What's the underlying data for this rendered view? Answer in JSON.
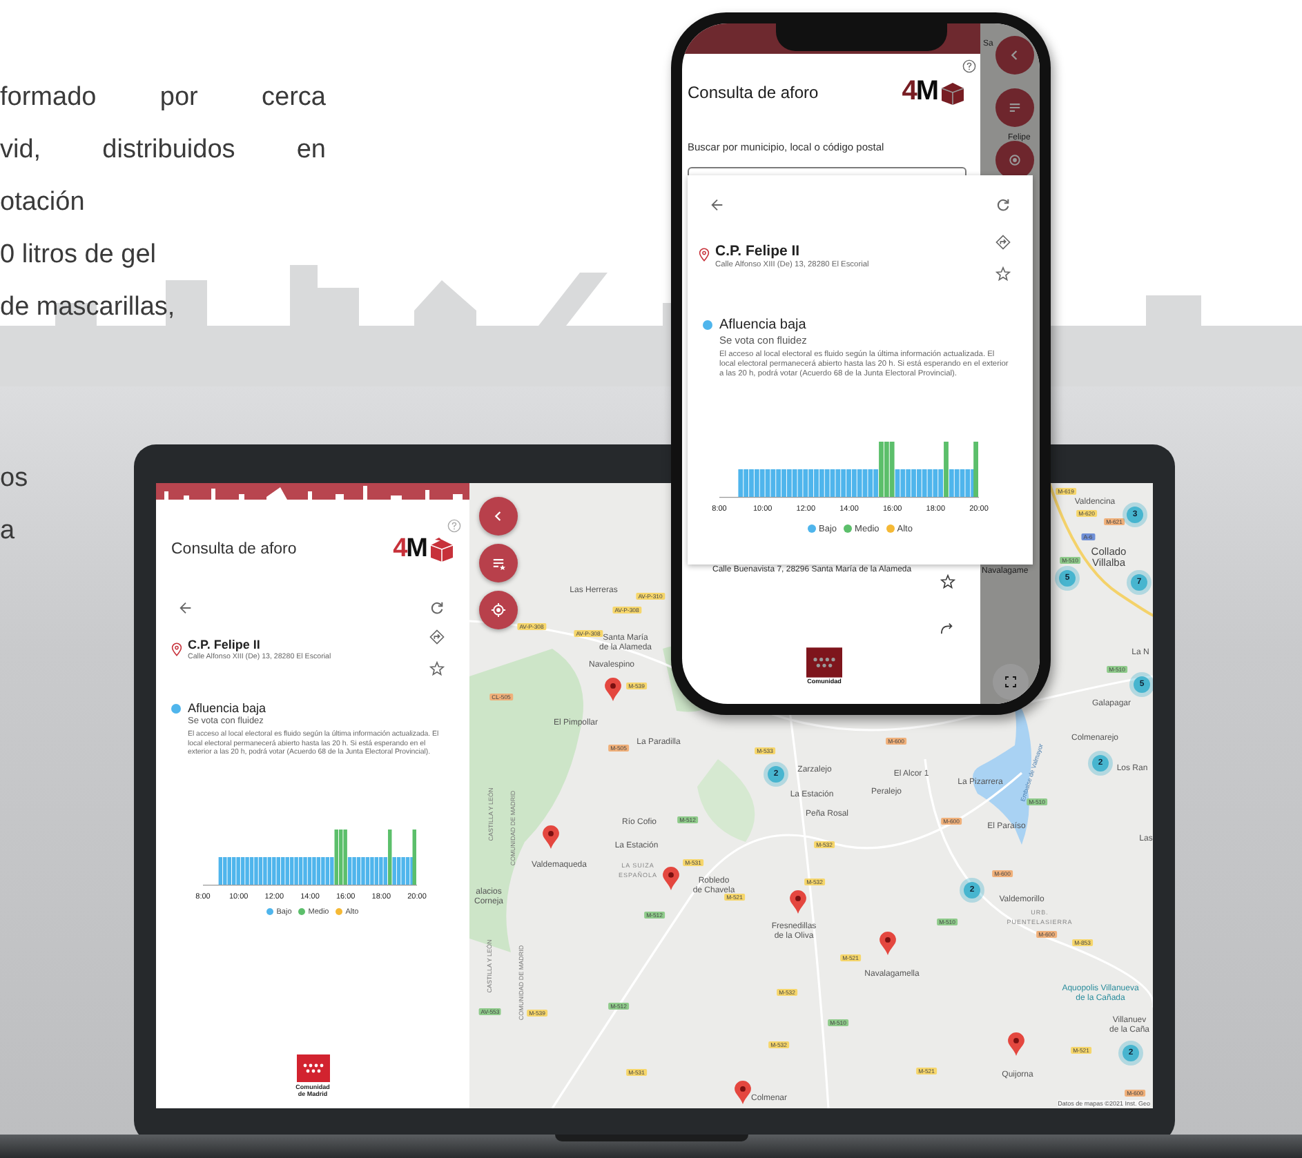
{
  "intro": {
    "paragraphs": [
      [
        {
          "text": "formado por cerca",
          "kind": "justified"
        },
        {
          "text": "vid, distribuidos en",
          "kind": "justified"
        },
        {
          "text": "otación",
          "kind": "plain"
        },
        {
          "text": "0 litros de gel",
          "kind": "plain"
        },
        {
          "text": "de mascarillas,",
          "kind": "plain"
        }
      ],
      [
        {
          "text": "os",
          "kind": "plain"
        },
        {
          "text": "a",
          "kind": "plain"
        }
      ]
    ]
  },
  "laptop": {
    "panel": {
      "title": "Consulta de aforo",
      "logo": {
        "digit": "4",
        "letter": "M"
      },
      "place": {
        "name": "C.P. Felipe II",
        "address": "Calle Alfonso XIII (De) 13, 28280 El Escorial"
      },
      "status": {
        "color": "#4fb5ec",
        "title": "Afluencia baja",
        "subtitle": "Se vota con fluidez",
        "description": "El acceso al local electoral es fluido según la última información actualizada. El local electoral permanecerá abierto hasta las 20 h. Si está esperando en el exterior a las 20 h, podrá votar (Acuerdo 68 de la Junta Electoral Provincial)."
      },
      "x_labels": [
        "8:00",
        "10:00",
        "12:00",
        "14:00",
        "16:00",
        "18:00",
        "20:00"
      ],
      "legend": [
        {
          "label": "Bajo",
          "color": "#4fb5ec"
        },
        {
          "label": "Medio",
          "color": "#5cbf6b"
        },
        {
          "label": "Alto",
          "color": "#f5b935"
        }
      ],
      "org": {
        "line1": "Comunidad",
        "line2": "de Madrid"
      }
    },
    "map": {
      "places": [
        {
          "text": "Las Herreras",
          "kind": "town"
        },
        {
          "text": "Santa María\nde la Alameda",
          "kind": "town"
        },
        {
          "text": "Navalespino",
          "kind": "town"
        },
        {
          "text": "El Pimpollar",
          "kind": "town"
        },
        {
          "text": "La Paradilla",
          "kind": "town"
        },
        {
          "text": "Zarzalejo",
          "kind": "town"
        },
        {
          "text": "La Estación",
          "kind": "town"
        },
        {
          "text": "Peña Rosal",
          "kind": "town"
        },
        {
          "text": "Peralejo",
          "kind": "town"
        },
        {
          "text": "El Alcor 1",
          "kind": "town"
        },
        {
          "text": "La Pizarrera",
          "kind": "town"
        },
        {
          "text": "El Paraíso",
          "kind": "town"
        },
        {
          "text": "Río Cofio",
          "kind": "town"
        },
        {
          "text": "La Estación",
          "kind": "town"
        },
        {
          "text": "Valdemaqueda",
          "kind": "town"
        },
        {
          "text": "LA SUIZA\nESPAÑOLA",
          "kind": "area"
        },
        {
          "text": "Robledo\nde Chavela",
          "kind": "town"
        },
        {
          "text": "Fresnedillas\nde la Oliva",
          "kind": "town"
        },
        {
          "text": "Navalagamella",
          "kind": "town"
        },
        {
          "text": "Valdemorillo",
          "kind": "town"
        },
        {
          "text": "URB.\nPUENTELASIERRA",
          "kind": "area"
        },
        {
          "text": "Aquopolis Villanueva\nde la Cañada",
          "kind": "poi"
        },
        {
          "text": "Villanuev\nde la Caña",
          "kind": "town"
        },
        {
          "text": "Quijorna",
          "kind": "town"
        },
        {
          "text": "Valdencina",
          "kind": "town"
        },
        {
          "text": "Collado\nVillalba",
          "kind": "city"
        },
        {
          "text": "La N",
          "kind": "town"
        },
        {
          "text": "Galapagar",
          "kind": "town"
        },
        {
          "text": "Colmenarejo",
          "kind": "town"
        },
        {
          "text": "Los Ran",
          "kind": "town"
        },
        {
          "text": "Las",
          "kind": "town"
        },
        {
          "text": "Colmenar",
          "kind": "town"
        },
        {
          "text": "alacios\nCorneja",
          "kind": "town"
        },
        {
          "text": "CASTILLA Y LEÓN",
          "kind": "border"
        },
        {
          "text": "COMUNIDAD DE MADRID",
          "kind": "border"
        },
        {
          "text": "CASTILLA Y LEÓN",
          "kind": "border"
        },
        {
          "text": "COMUNIDAD DE MADRID",
          "kind": "border"
        },
        {
          "text": "Embalse de Valmayor",
          "kind": "water"
        }
      ],
      "roads": [
        {
          "text": "AV-P-310",
          "color": "#f6d66b"
        },
        {
          "text": "AV-P-308",
          "color": "#f6d66b"
        },
        {
          "text": "AV-P-308",
          "color": "#f6d66b"
        },
        {
          "text": "AV-P-308",
          "color": "#f6d66b"
        },
        {
          "text": "M-539",
          "color": "#f6d66b"
        },
        {
          "text": "CL-505",
          "color": "#f0b07a"
        },
        {
          "text": "M-505",
          "color": "#f0b07a"
        },
        {
          "text": "M-533",
          "color": "#f6d66b"
        },
        {
          "text": "M-512",
          "color": "#8fcb8b"
        },
        {
          "text": "M-531",
          "color": "#f6d66b"
        },
        {
          "text": "M-521",
          "color": "#f6d66b"
        },
        {
          "text": "M-532",
          "color": "#f6d66b"
        },
        {
          "text": "M-532",
          "color": "#f6d66b"
        },
        {
          "text": "M-512",
          "color": "#8fcb8b"
        },
        {
          "text": "M-521",
          "color": "#f6d66b"
        },
        {
          "text": "M-532",
          "color": "#f6d66b"
        },
        {
          "text": "M-510",
          "color": "#8fcb8b"
        },
        {
          "text": "M-532",
          "color": "#f6d66b"
        },
        {
          "text": "M-531",
          "color": "#f6d66b"
        },
        {
          "text": "AV-553",
          "color": "#8fcb8b"
        },
        {
          "text": "M-539",
          "color": "#f6d66b"
        },
        {
          "text": "M-512",
          "color": "#8fcb8b"
        },
        {
          "text": "M-619",
          "color": "#f6d66b"
        },
        {
          "text": "M-620",
          "color": "#f6d66b"
        },
        {
          "text": "M-621",
          "color": "#f0b07a"
        },
        {
          "text": "A-6",
          "color": "#6f8fd6"
        },
        {
          "text": "M-510",
          "color": "#8fcb8b"
        },
        {
          "text": "M-510",
          "color": "#8fcb8b"
        },
        {
          "text": "M-600",
          "color": "#f0b07a"
        },
        {
          "text": "M-600",
          "color": "#f0b07a"
        },
        {
          "text": "M-510",
          "color": "#8fcb8b"
        },
        {
          "text": "M-600",
          "color": "#f0b07a"
        },
        {
          "text": "M-510",
          "color": "#8fcb8b"
        },
        {
          "text": "M-600",
          "color": "#f0b07a"
        },
        {
          "text": "M-853",
          "color": "#f6d66b"
        },
        {
          "text": "M-521",
          "color": "#f6d66b"
        },
        {
          "text": "M-521",
          "color": "#f6d66b"
        },
        {
          "text": "M-600",
          "color": "#f0b07a"
        }
      ],
      "markers": [
        {
          "kind": "pin"
        },
        {
          "kind": "pin"
        },
        {
          "kind": "pin"
        },
        {
          "kind": "pin"
        },
        {
          "kind": "pin"
        },
        {
          "kind": "pin"
        },
        {
          "kind": "pin"
        },
        {
          "kind": "cluster",
          "count": "2"
        },
        {
          "kind": "cluster",
          "count": "3"
        },
        {
          "kind": "cluster",
          "count": "5"
        },
        {
          "kind": "cluster",
          "count": "7"
        },
        {
          "kind": "cluster",
          "count": "5"
        },
        {
          "kind": "cluster",
          "count": "2"
        },
        {
          "kind": "cluster",
          "count": "2"
        },
        {
          "kind": "cluster",
          "count": "2"
        }
      ],
      "attribution": "Datos de mapas ©2021 Inst. Geo"
    }
  },
  "phone": {
    "title": "Consulta de aforo",
    "logo": {
      "digit": "4",
      "letter": "M"
    },
    "search_label": "Buscar por municipio, local o código postal",
    "list_address": "Calle Buenavista 7, 28296 Santa María de la Alameda",
    "org": {
      "line1": "Comunidad"
    },
    "map_labels": [
      "Sa",
      "Felipe",
      "Navalagame"
    ],
    "card": {
      "place": {
        "name": "C.P. Felipe II",
        "address": "Calle Alfonso XIII (De) 13, 28280 El Escorial"
      },
      "status": {
        "color": "#4fb5ec",
        "title": "Afluencia baja",
        "subtitle": "Se vota con fluidez",
        "description": "El acceso al local electoral es fluido según la última información actualizada. El local electoral permanecerá abierto hasta las 20 h. Si está esperando en el exterior a las 20 h, podrá votar (Acuerdo 68 de la Junta Electoral Provincial)."
      },
      "x_labels": [
        "8:00",
        "10:00",
        "12:00",
        "14:00",
        "16:00",
        "18:00",
        "20:00"
      ],
      "legend": [
        {
          "label": "Bajo",
          "color": "#4fb5ec"
        },
        {
          "label": "Medio",
          "color": "#5cbf6b"
        },
        {
          "label": "Alto",
          "color": "#f5b935"
        }
      ]
    }
  }
}
